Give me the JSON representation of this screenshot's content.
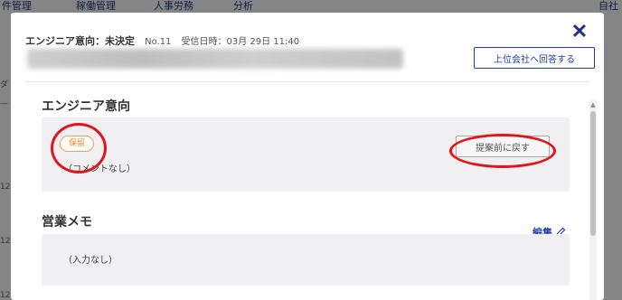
{
  "background": {
    "nav": [
      "件管理",
      "稼働管理",
      "人事労務",
      "分析",
      "自社"
    ],
    "side_marks": [
      "ダ",
      "12",
      "12",
      "12"
    ]
  },
  "modal": {
    "title": "エンジニア意向：未決定",
    "number": "No.11",
    "received": "受信日時：03月 29日 11:40",
    "reply_button": "上位会社へ回答する",
    "close_icon": "close-icon"
  },
  "engineer_intent": {
    "heading": "エンジニア意向",
    "status_badge": "保留",
    "comment": "（コメントなし）",
    "revert_button": "提案前に戻す"
  },
  "sales_memo": {
    "heading": "営業メモ",
    "edit_label": "編集",
    "edit_icon": "pencil-icon",
    "content": "（入力なし）"
  },
  "colors": {
    "accent": "#1f3da6",
    "badge": "#f08a24",
    "annotation": "#e3141a"
  }
}
